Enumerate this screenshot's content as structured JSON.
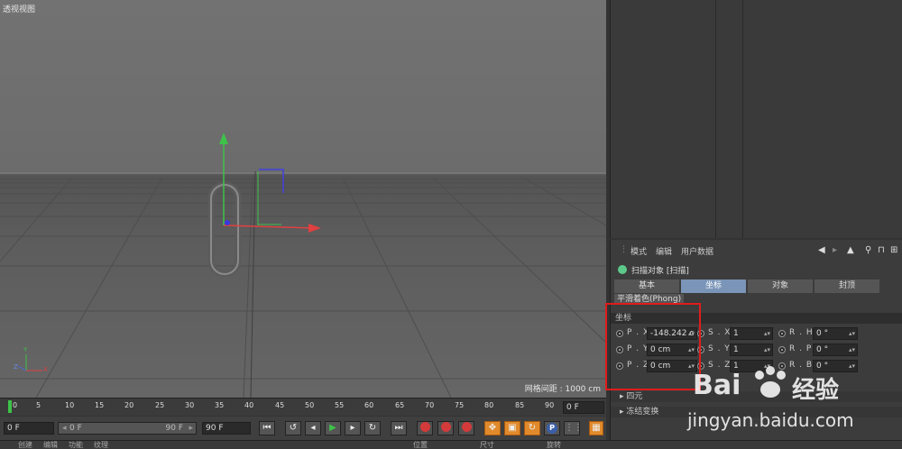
{
  "viewport": {
    "title": "透视视图",
    "grid_spacing": "网格间距 : 1000 cm",
    "axis_labels": {
      "y": "Y",
      "z": "Z",
      "x": "X"
    }
  },
  "attributes": {
    "menu": [
      "模式",
      "编辑",
      "用户数据"
    ],
    "nav_icons": [
      "arrow-left-icon",
      "arrow-up-icon",
      "search-icon",
      "lock-icon",
      "new-panel-icon"
    ],
    "object_title": "扫描对象 [扫描]",
    "tabs": [
      {
        "label": "基本",
        "active": false
      },
      {
        "label": "坐标",
        "active": true
      },
      {
        "label": "对象",
        "active": false
      },
      {
        "label": "封顶",
        "active": false
      }
    ],
    "phong": "平滑着色(Phong)",
    "section": "坐标",
    "position": [
      {
        "label": "P . X",
        "value": "-148.242 c"
      },
      {
        "label": "P . Y",
        "value": "0 cm"
      },
      {
        "label": "P . Z",
        "value": "0 cm"
      }
    ],
    "scale": [
      {
        "label": "S . X",
        "value": "1"
      },
      {
        "label": "S . Y",
        "value": "1"
      },
      {
        "label": "S . Z",
        "value": "1"
      }
    ],
    "rotation": [
      {
        "label": "R . H",
        "value": "0 °"
      },
      {
        "label": "R . P",
        "value": "0 °"
      },
      {
        "label": "R . B",
        "value": "0 °"
      }
    ],
    "quaternion": "四元",
    "freeze": "冻结变换"
  },
  "timeline": {
    "ticks": [
      "0",
      "5",
      "10",
      "15",
      "20",
      "25",
      "30",
      "35",
      "40",
      "45",
      "50",
      "55",
      "60",
      "65",
      "70",
      "75",
      "80",
      "85",
      "90"
    ],
    "current_frame_right": "0 F",
    "start_frame": "0 F",
    "range_start": "0 F",
    "range_end": "90 F",
    "end_frame": "90 F"
  },
  "bottom_tabs": [
    "创建",
    "编辑",
    "功能",
    "纹理",
    "位置",
    "尺寸",
    "旋转"
  ],
  "watermark": {
    "brand": "Bai",
    "brand2": "经验",
    "url": "jingyan.baidu.com"
  },
  "colors": {
    "accent_tab": "#7a95b8",
    "highlight_box": "#e01c1c",
    "playhead": "#3ec24a"
  }
}
